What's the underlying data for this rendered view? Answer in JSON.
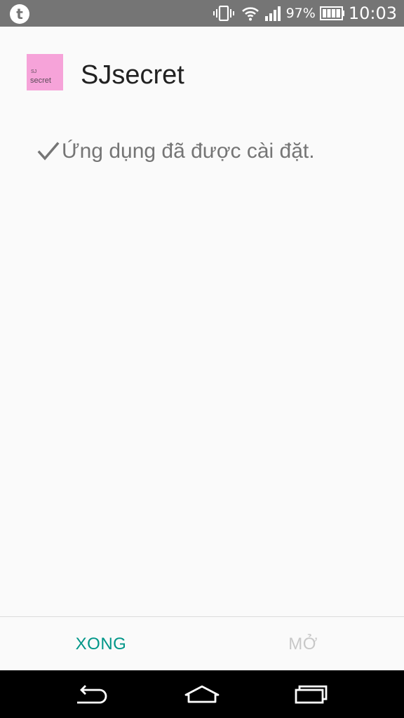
{
  "status_bar": {
    "notification_icon": "tumblr-icon",
    "notification_glyph": "t",
    "battery_percent": "97%",
    "time": "10:03",
    "icons": [
      "vibrate-icon",
      "wifi-icon",
      "signal-icon",
      "battery-icon"
    ]
  },
  "app": {
    "name": "SJsecret",
    "icon_text_top": "SJ",
    "icon_text_bottom": "secret",
    "icon_color": "#f6a3d9"
  },
  "message": {
    "text": "Ứng dụng đã được cài đặt.",
    "icon": "checkmark-icon"
  },
  "actions": {
    "done_label": "XONG",
    "open_label": "MỞ",
    "done_color": "#009688",
    "open_color": "#c8c8c8"
  },
  "nav": {
    "icons": [
      "back-icon",
      "home-icon",
      "recents-icon"
    ]
  }
}
